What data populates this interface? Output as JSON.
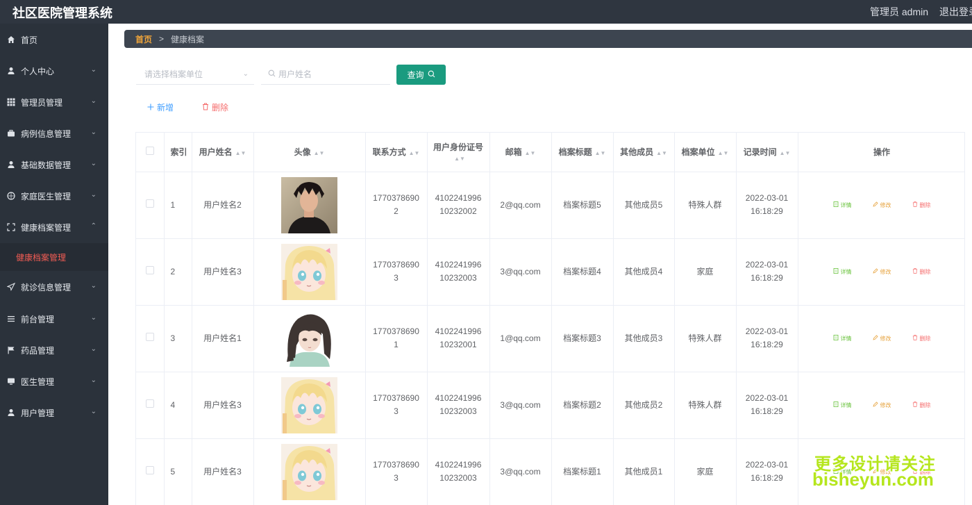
{
  "app": {
    "title": "社区医院管理系统",
    "user_label": "管理员 admin",
    "logout_label": "退出登录"
  },
  "sidebar": {
    "items": [
      {
        "label": "首页",
        "icon": "home-icon",
        "has_children": false
      },
      {
        "label": "个人中心",
        "icon": "user-icon",
        "has_children": true
      },
      {
        "label": "管理员管理",
        "icon": "grid-icon",
        "has_children": true
      },
      {
        "label": "病例信息管理",
        "icon": "briefcase-icon",
        "has_children": true
      },
      {
        "label": "基础数据管理",
        "icon": "user-icon",
        "has_children": true
      },
      {
        "label": "家庭医生管理",
        "icon": "compass-icon",
        "has_children": true
      },
      {
        "label": "健康档案管理",
        "icon": "frame-icon",
        "has_children": true,
        "expanded": true
      },
      {
        "label": "就诊信息管理",
        "icon": "send-icon",
        "has_children": true
      },
      {
        "label": "前台管理",
        "icon": "menu-lines-icon",
        "has_children": true
      },
      {
        "label": "药品管理",
        "icon": "flag-icon",
        "has_children": true
      },
      {
        "label": "医生管理",
        "icon": "monitor-icon",
        "has_children": true
      },
      {
        "label": "用户管理",
        "icon": "user-icon",
        "has_children": true
      }
    ],
    "active_submenu": "健康档案管理"
  },
  "breadcrumb": {
    "home": "首页",
    "separator": ">",
    "current": "健康档案"
  },
  "filters": {
    "unit_placeholder": "请选择档案单位",
    "name_placeholder": "用户姓名",
    "query_label": "查询"
  },
  "actions": {
    "add_label": "新增",
    "delete_label": "删除"
  },
  "table": {
    "columns": [
      "索引",
      "用户姓名",
      "头像",
      "联系方式",
      "用户身份证号",
      "邮箱",
      "档案标题",
      "其他成员",
      "档案单位",
      "记录时间",
      "操作"
    ],
    "op_labels": {
      "detail": "详情",
      "edit": "修改",
      "delete": "删除"
    },
    "rows": [
      {
        "index": "1",
        "name": "用户姓名2",
        "avatar": "photo-man",
        "phone": "17703786902",
        "id_no": "410224199610232002",
        "email": "2@qq.com",
        "title": "档案标题5",
        "members": "其他成员5",
        "unit": "特殊人群",
        "time": "2022-03-01 16:18:29"
      },
      {
        "index": "2",
        "name": "用户姓名3",
        "avatar": "anime-blonde",
        "phone": "17703786903",
        "id_no": "410224199610232003",
        "email": "3@qq.com",
        "title": "档案标题4",
        "members": "其他成员4",
        "unit": "家庭",
        "time": "2022-03-01 16:18:29"
      },
      {
        "index": "3",
        "name": "用户姓名1",
        "avatar": "anime-dark",
        "phone": "17703786901",
        "id_no": "410224199610232001",
        "email": "1@qq.com",
        "title": "档案标题3",
        "members": "其他成员3",
        "unit": "特殊人群",
        "time": "2022-03-01 16:18:29"
      },
      {
        "index": "4",
        "name": "用户姓名3",
        "avatar": "anime-blonde",
        "phone": "17703786903",
        "id_no": "410224199610232003",
        "email": "3@qq.com",
        "title": "档案标题2",
        "members": "其他成员2",
        "unit": "特殊人群",
        "time": "2022-03-01 16:18:29"
      },
      {
        "index": "5",
        "name": "用户姓名3",
        "avatar": "anime-blonde",
        "phone": "17703786903",
        "id_no": "410224199610232003",
        "email": "3@qq.com",
        "title": "档案标题1",
        "members": "其他成员1",
        "unit": "家庭",
        "time": "2022-03-01 16:18:29"
      }
    ]
  },
  "watermark": {
    "line1": "更多设计请关注",
    "line2": "bisheyun.com"
  },
  "colors": {
    "topbar": "#2f3640",
    "sidebar": "#2b323b",
    "accent": "#1a9b7f",
    "active_menu": "#f25c54",
    "breadcrumb_home": "#f0a53a",
    "detail": "#67c23a",
    "edit": "#e6a23c",
    "delete": "#f56c6c",
    "add": "#409eff"
  }
}
